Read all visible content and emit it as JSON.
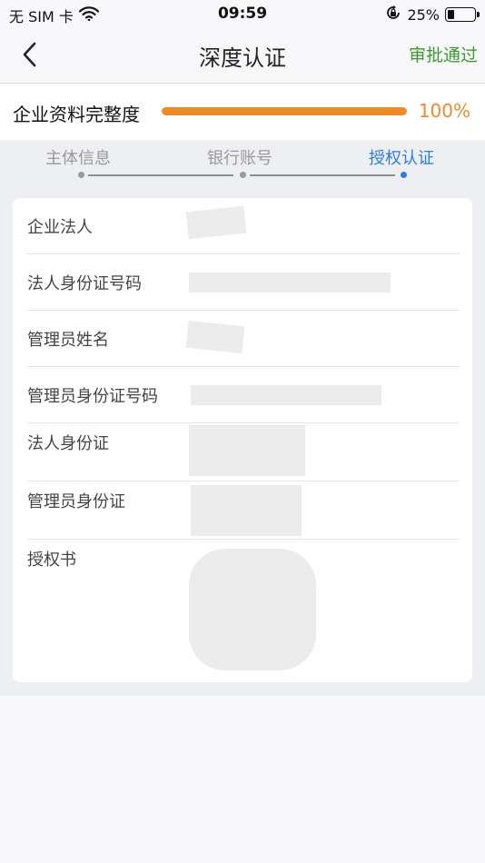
{
  "status_bar": {
    "carrier": "无 SIM 卡",
    "time": "09:59",
    "battery": "25%",
    "battery_level": 0.25
  },
  "nav": {
    "title": "深度认证",
    "action": "审批通过"
  },
  "completeness": {
    "label": "企业资料完整度",
    "value": "100%",
    "progress": 1.0
  },
  "steps": [
    {
      "label": "主体信息",
      "active": false
    },
    {
      "label": "银行账号",
      "active": false
    },
    {
      "label": "授权认证",
      "active": true
    }
  ],
  "fields": [
    {
      "label": "企业法人"
    },
    {
      "label": "法人身份证号码"
    },
    {
      "label": "管理员姓名"
    },
    {
      "label": "管理员身份证号码"
    },
    {
      "label": "法人身份证"
    },
    {
      "label": "管理员身份证"
    },
    {
      "label": "授权书"
    }
  ],
  "colors": {
    "accent_green": "#3c9a2f",
    "progress_orange": "#f0892a",
    "step_active_blue": "#2b7de1"
  },
  "icons": {
    "back": "chevron-left-icon",
    "wifi": "wifi-icon",
    "lock": "orientation-lock-icon",
    "battery": "battery-icon"
  }
}
